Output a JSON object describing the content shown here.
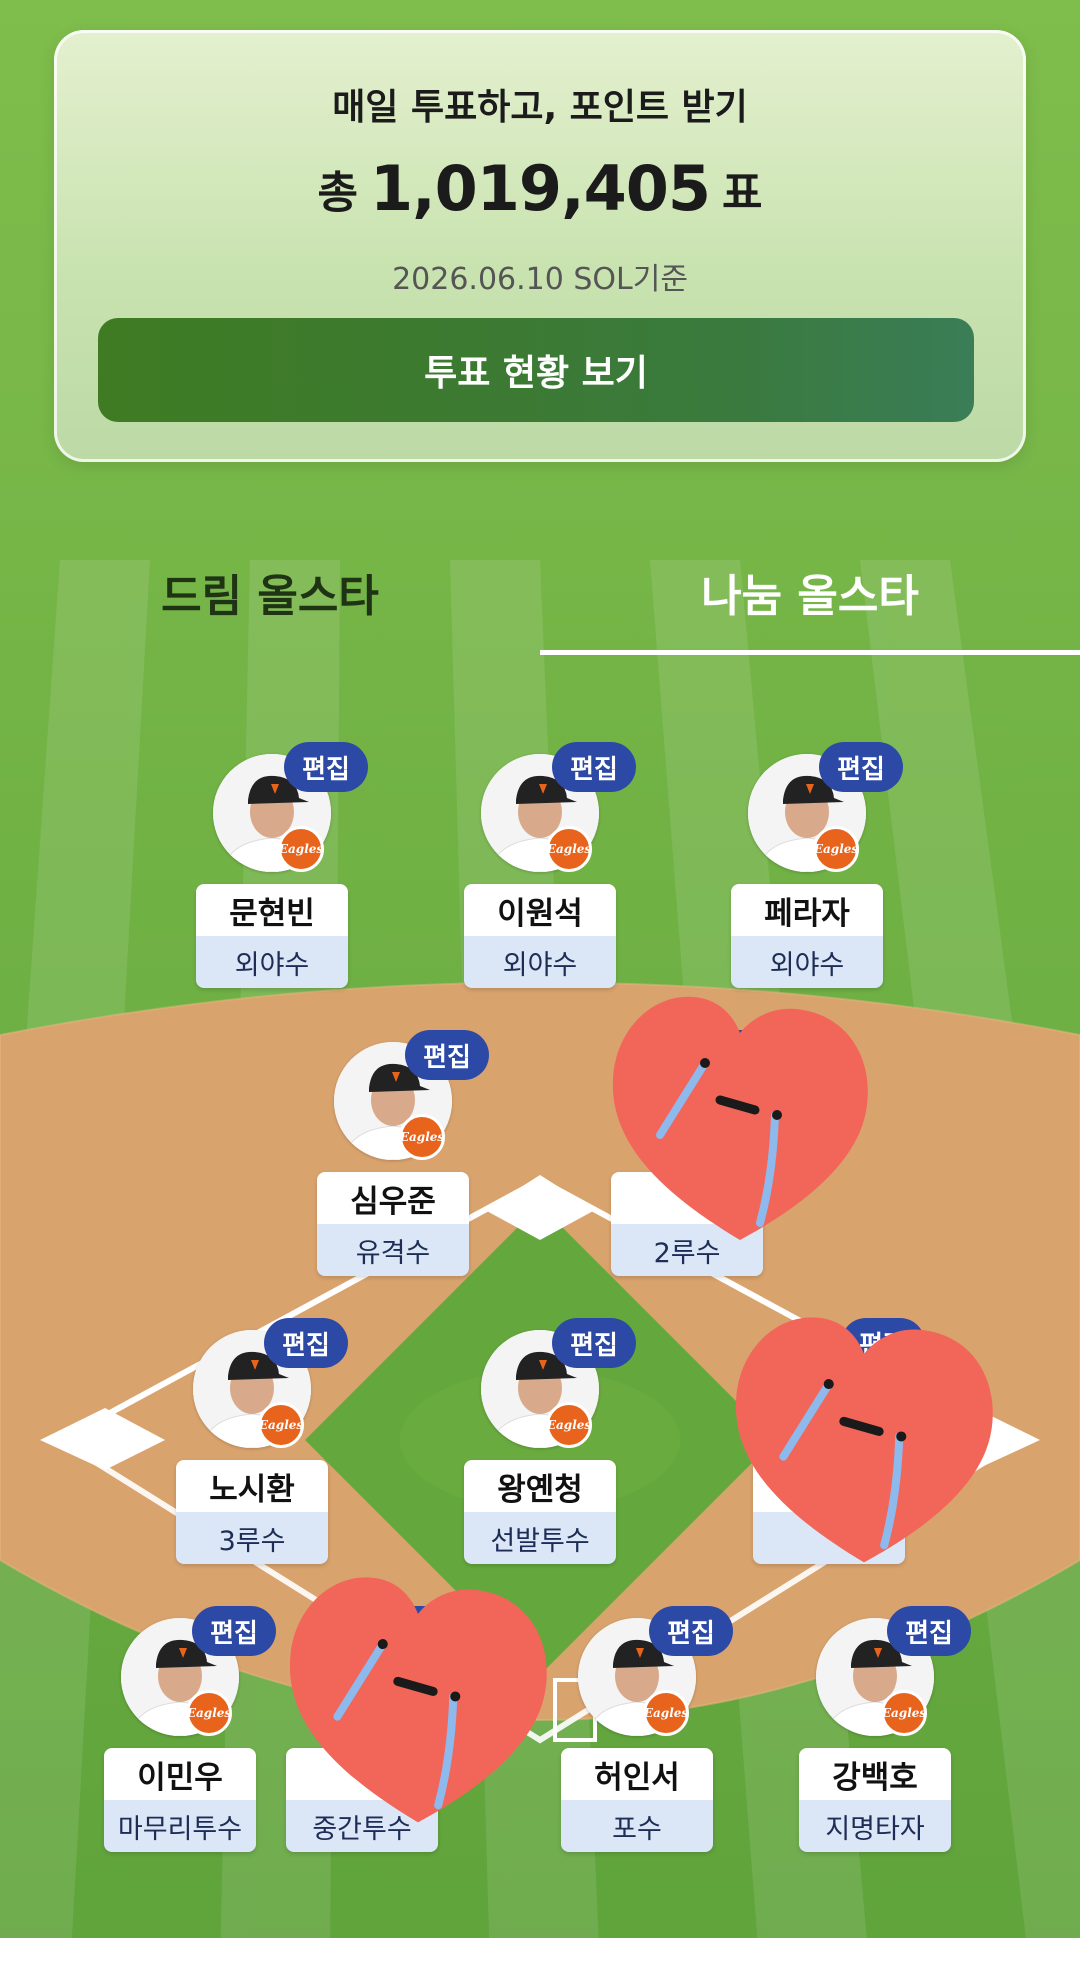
{
  "summary": {
    "title": "매일 투표하고, 포인트 받기",
    "total_prefix": "총",
    "total_value": "1,019,405",
    "total_suffix": "표",
    "date": "2026.06.10 SOL기준",
    "button_label": "투표 현황 보기"
  },
  "tabs": [
    {
      "label": "드림 올스타",
      "selected": false
    },
    {
      "label": "나눔 올스타",
      "selected": true
    }
  ],
  "edit_label": "편집",
  "team_logo_text": "Eagles",
  "players": [
    {
      "name": "문현빈",
      "position": "외야수"
    },
    {
      "name": "이원석",
      "position": "외야수"
    },
    {
      "name": "페라자",
      "position": "외야수"
    },
    {
      "name": "심우준",
      "position": "유격수"
    },
    {
      "name": "",
      "position": "2루수"
    },
    {
      "name": "노시환",
      "position": "3루수"
    },
    {
      "name": "왕옌청",
      "position": "선발투수"
    },
    {
      "name": "",
      "position": ""
    },
    {
      "name": "이민우",
      "position": "마무리투수"
    },
    {
      "name": "",
      "position": "중간투수"
    },
    {
      "name": "허인서",
      "position": "포수"
    },
    {
      "name": "강백호",
      "position": "지명타자"
    }
  ],
  "colors": {
    "edit_badge": "#2c49a6",
    "button": "#3f7b22",
    "team_badge": "#e8641d",
    "heart_sticker": "#f26559"
  },
  "icons": {
    "player_photo": "player-photo-icon",
    "team_logo": "eagles-logo-icon",
    "sticker": "crying-heart-sticker"
  }
}
